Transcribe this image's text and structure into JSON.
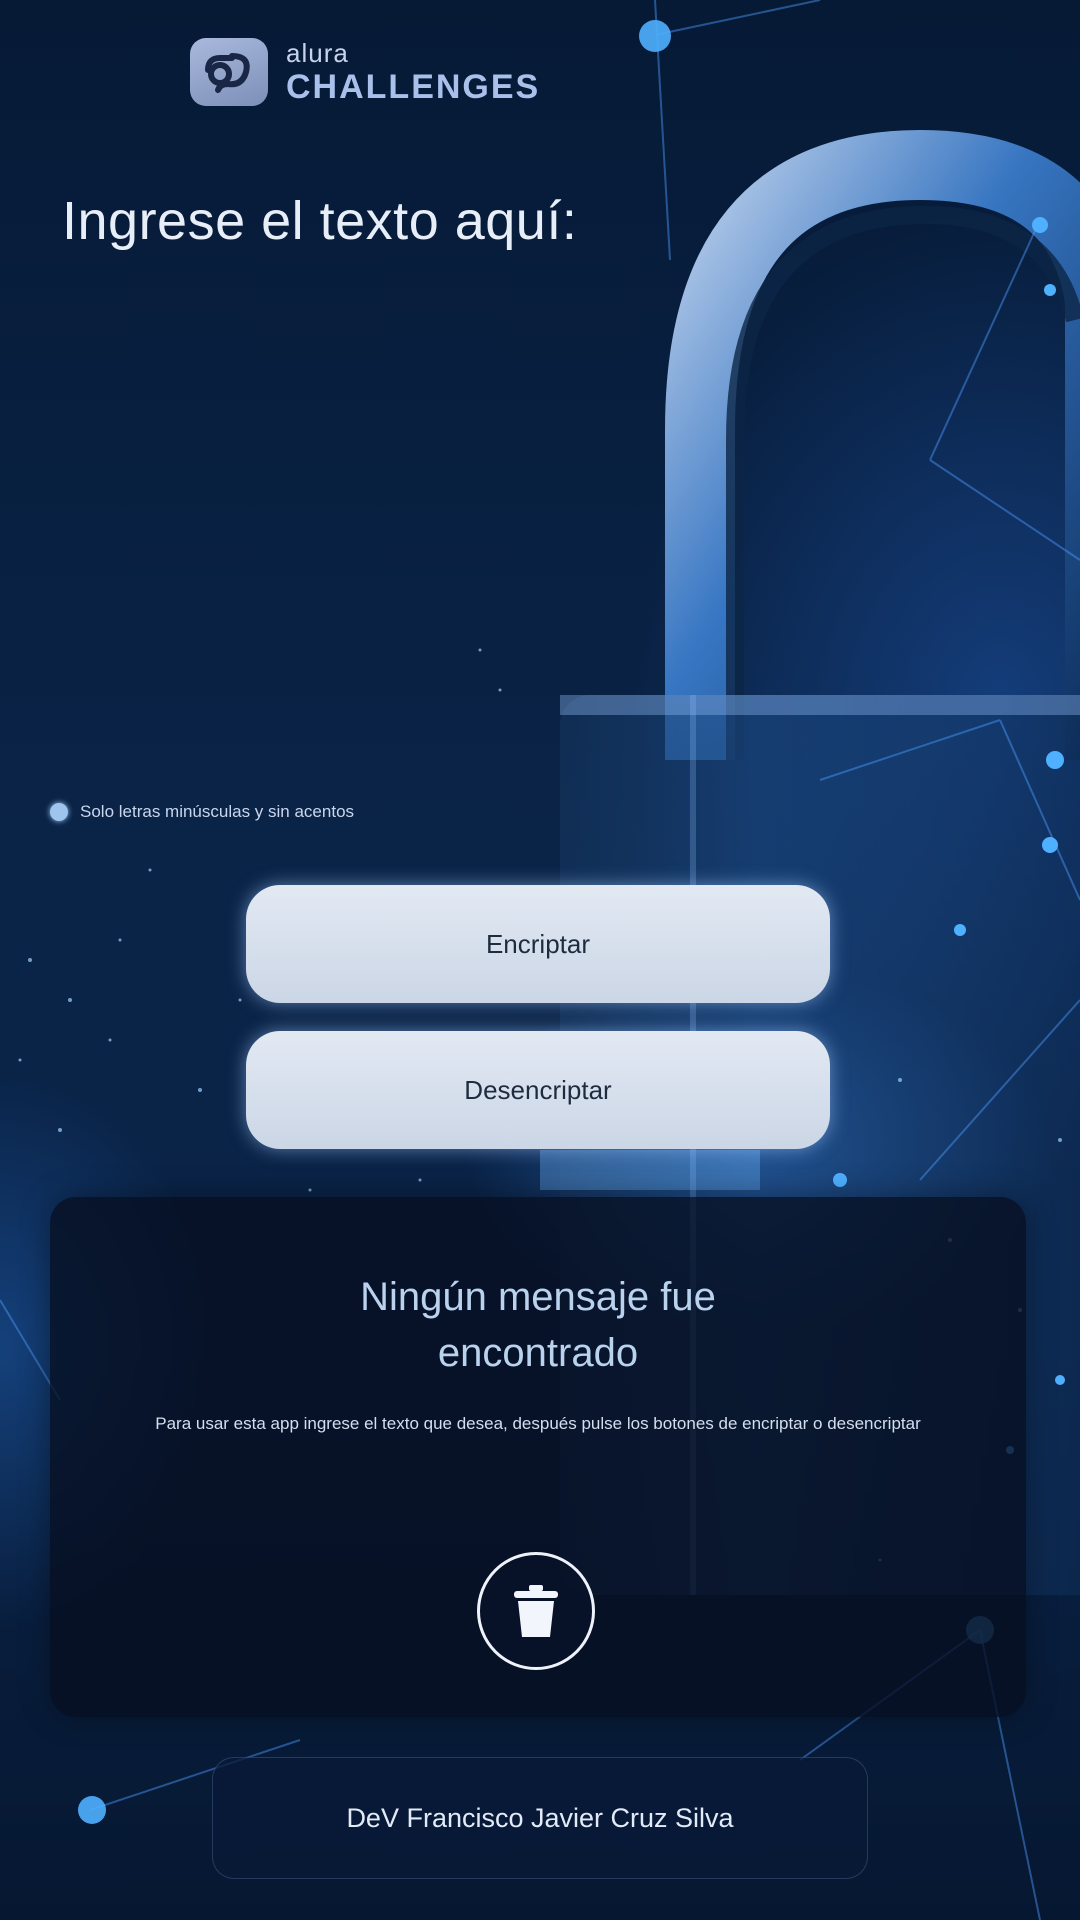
{
  "brand": {
    "top": "alura",
    "bottom": "CHALLENGES"
  },
  "input": {
    "heading": "Ingrese el texto aquí:",
    "value": ""
  },
  "hint": "Solo letras minúsculas y sin acentos",
  "buttons": {
    "encrypt": "Encriptar",
    "decrypt": "Desencriptar"
  },
  "result": {
    "title_line1": "Ningún mensaje fue",
    "title_line2": "encontrado",
    "description": "Para usar esta app ingrese el texto que desea, después pulse los botones de encriptar o desencriptar"
  },
  "footer": {
    "credit": "DeV Francisco Javier Cruz Silva"
  },
  "icons": {
    "logo": "alura-logo-icon",
    "trash": "trash-icon",
    "hint": "info-dot-icon"
  },
  "colors": {
    "background": "#0a2448",
    "button": "#d6dfec",
    "panel": "#060e20",
    "accent": "#4aa3ff"
  }
}
